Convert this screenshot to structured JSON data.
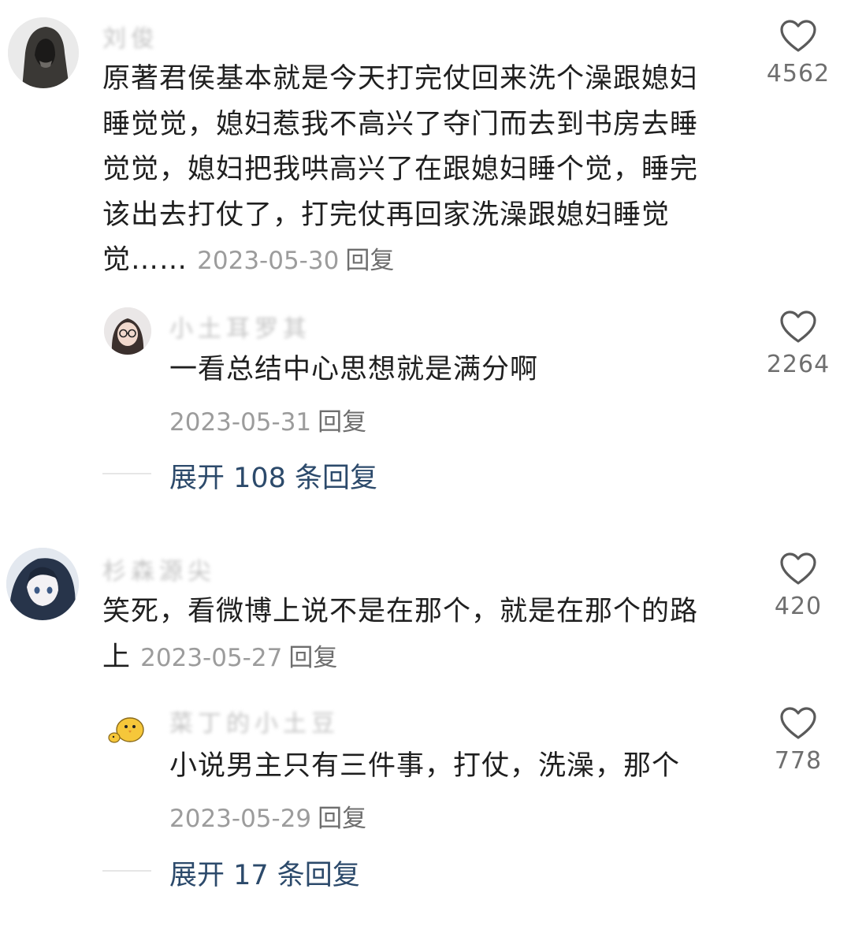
{
  "comments": [
    {
      "username": "刘俊",
      "text": "原著君侯基本就是今天打完仗回来洗个澡跟媳妇睡觉觉，媳妇惹我不高兴了夺门而去到书房去睡觉觉，媳妇把我哄高兴了在跟媳妇睡个觉，睡完该出去打仗了，打完仗再回家洗澡跟媳妇睡觉觉……",
      "date": "2023-05-30",
      "reply_label": "回复",
      "likes": "4562",
      "avatar_icon": "hooded-figure-avatar",
      "reply": {
        "username": "小土耳罗其",
        "text": "一看总结中心思想就是满分啊",
        "date": "2023-05-31",
        "reply_label": "回复",
        "likes": "2264",
        "avatar_icon": "glasses-girl-avatar"
      },
      "expand_label": "展开 108 条回复"
    },
    {
      "username": "杉森源尖",
      "text": "笑死，看微博上说不是在那个，就是在那个的路上",
      "date": "2023-05-27",
      "reply_label": "回复",
      "likes": "420",
      "avatar_icon": "anime-girl-avatar",
      "reply": {
        "username": "菜丁的小土豆",
        "text": "小说男主只有三件事，打仗，洗澡，那个",
        "date": "2023-05-29",
        "reply_label": "回复",
        "likes": "778",
        "avatar_icon": "yellow-chick-avatar"
      },
      "expand_label": "展开 17 条回复"
    }
  ],
  "colors": {
    "accent_expand": "#2c4a6b",
    "meta_gray": "#9c9c9c",
    "text": "#1f1f1f"
  }
}
